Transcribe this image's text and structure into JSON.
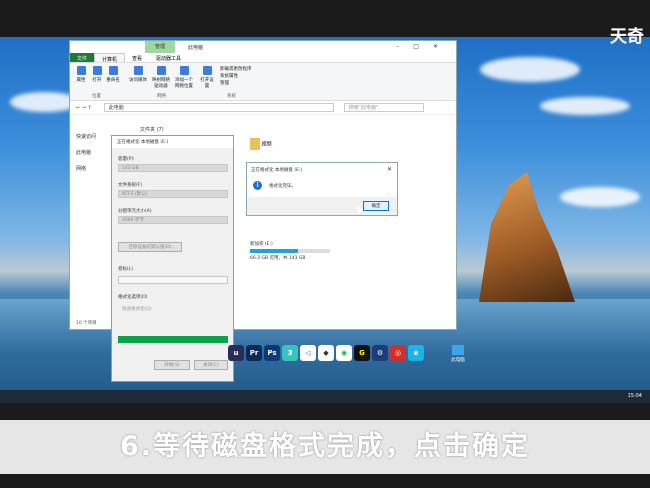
{
  "logo": "天奇",
  "explorer": {
    "title": "此电脑",
    "manage_tab": "管理",
    "tabs": [
      "文件",
      "计算机",
      "查看",
      "驱动器工具"
    ],
    "ribbon": [
      "属性",
      "打开",
      "重命名",
      "访问媒体",
      "映射网络驱动器",
      "添加一个网络位置",
      "打开设置",
      "卸载或更改程序",
      "系统属性",
      "管理"
    ],
    "groups": [
      "位置",
      "网络",
      "系统"
    ],
    "address": "此电脑",
    "search_placeholder": "搜索\"此电脑\"",
    "nav": [
      "快速访问",
      "此电脑",
      "网络"
    ],
    "folders_header": "文件夹 (7)",
    "folder_video": "视频",
    "drive_name": "新加卷 (E:)",
    "drive_space": "66.3 GB 可用，共 143 GB",
    "status": "10 个项目"
  },
  "format_dialog": {
    "title": "正在格式化 本地磁盘 (E:)",
    "capacity_label": "容量(P):",
    "capacity_value": "143 GB",
    "fs_label": "文件系统(F)",
    "fs_value": "NTFS (默认)",
    "alloc_label": "分配单元大小(A)",
    "alloc_value": "4096 字节",
    "restore_btn": "还原设备的默认值(D)",
    "volume_label": "卷标(L)",
    "options_label": "格式化选项(O)",
    "quick_format": "快速格式化(Q)",
    "start_btn": "开始(S)",
    "close_btn": "关闭(C)"
  },
  "done_dialog": {
    "title": "正在格式化 本地磁盘 (E:)",
    "message": "格式化完毕。",
    "ok": "确定"
  },
  "taskbar": {
    "clock": "15:04"
  },
  "desktop_icon": "此电脑",
  "caption": "6.等待磁盘格式完成，点击确定"
}
